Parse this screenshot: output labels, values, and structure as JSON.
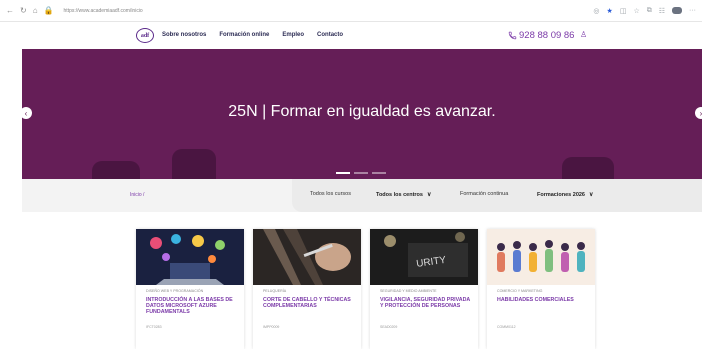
{
  "browser": {
    "url": "https://www.academiaadf.com/inicio"
  },
  "header": {
    "logo_text": "adf",
    "menu": [
      "Sobre nosotros",
      "Formación online",
      "Empleo",
      "Contacto"
    ],
    "phone": "928 88 09 86"
  },
  "hero": {
    "title": "25N | Formar en igualdad es avanzar."
  },
  "filters": {
    "breadcrumb": "Inicio /",
    "tabs": [
      "Todos los cursos",
      "Todos los centros",
      "Formación continua",
      "Formaciones 2026"
    ]
  },
  "courses": [
    {
      "category": "DISEÑO WEB Y PROGRAMACIÓN",
      "title": "INTRODUCCIÓN A LAS BASES DE DATOS MICROSOFT AZURE FUNDAMENTALS",
      "code": "IFCT0283"
    },
    {
      "category": "PELUQUERÍA",
      "title": "CORTE DE CABELLO Y TÉCNICAS COMPLEMENTARIAS",
      "code": "IMPP0009"
    },
    {
      "category": "SEGURIDAD Y MEDIO AMBIENTE",
      "title": "VIGILANCIA, SEGURIDAD PRIVADA Y PROTECCIÓN DE PERSONAS",
      "code": "SEAD0209"
    },
    {
      "category": "COMERCIO Y MARKETING",
      "title": "HABILIDADES COMERCIALES",
      "code": "COMM0112"
    }
  ],
  "colors": {
    "hero_bg": "#651e57",
    "accent": "#7b3aa8"
  }
}
